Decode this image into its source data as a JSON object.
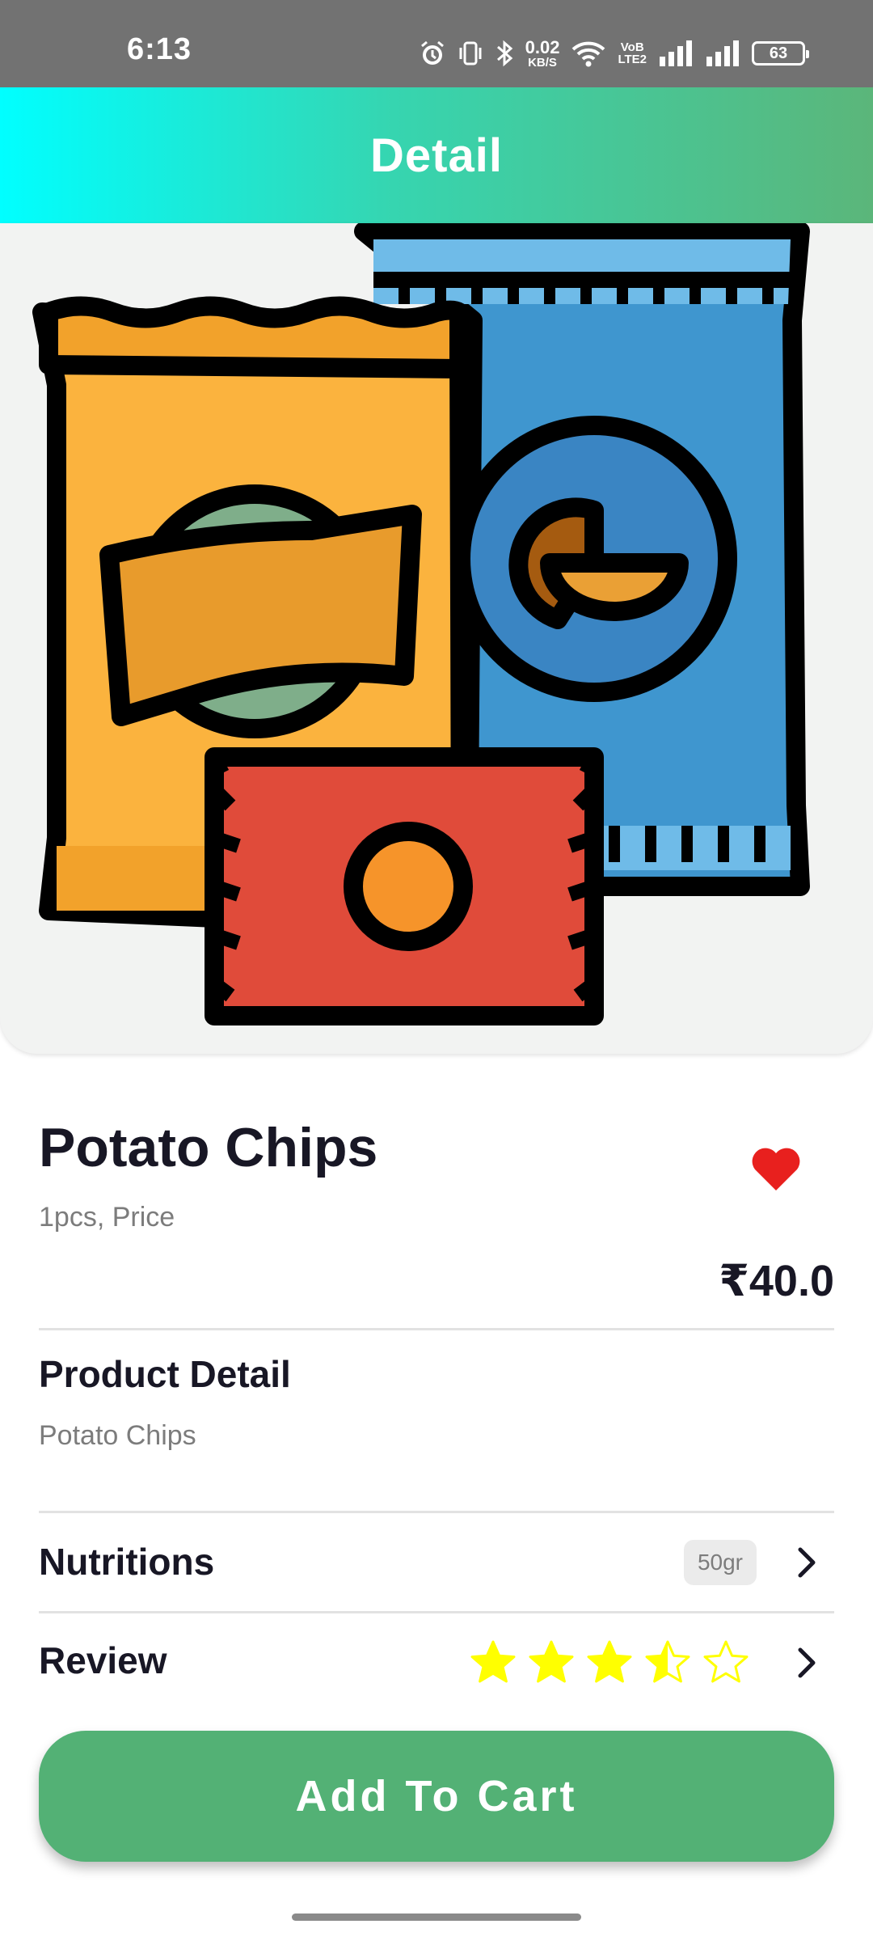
{
  "status_bar": {
    "time": "6:13",
    "net_speed_value": "0.02",
    "net_speed_unit": "KB/S",
    "volte_top": "VoB",
    "volte_bottom": "LTE2",
    "battery": "63",
    "icons": [
      "alarm-icon",
      "vibrate-icon",
      "bluetooth-icon",
      "wifi-icon",
      "signal-icon",
      "signal-icon",
      "battery-icon"
    ]
  },
  "header": {
    "title": "Detail"
  },
  "product": {
    "name": "Potato Chips",
    "subtitle": "1pcs, Price",
    "price": "₹40.0",
    "favorite": true,
    "image_icon": "chips-packets-illustration"
  },
  "detail": {
    "title": "Product Detail",
    "text": "Potato Chips"
  },
  "nutritions": {
    "label": "Nutritions",
    "badge": "50gr"
  },
  "review": {
    "label": "Review",
    "rating": 3.5,
    "max": 5
  },
  "cta": {
    "label": "Add To Cart"
  },
  "colors": {
    "primary": "#53B175",
    "header_start": "#00FFFF",
    "header_end": "#5BB67A",
    "heart": "#E8201E",
    "star": "#FFFF00"
  }
}
